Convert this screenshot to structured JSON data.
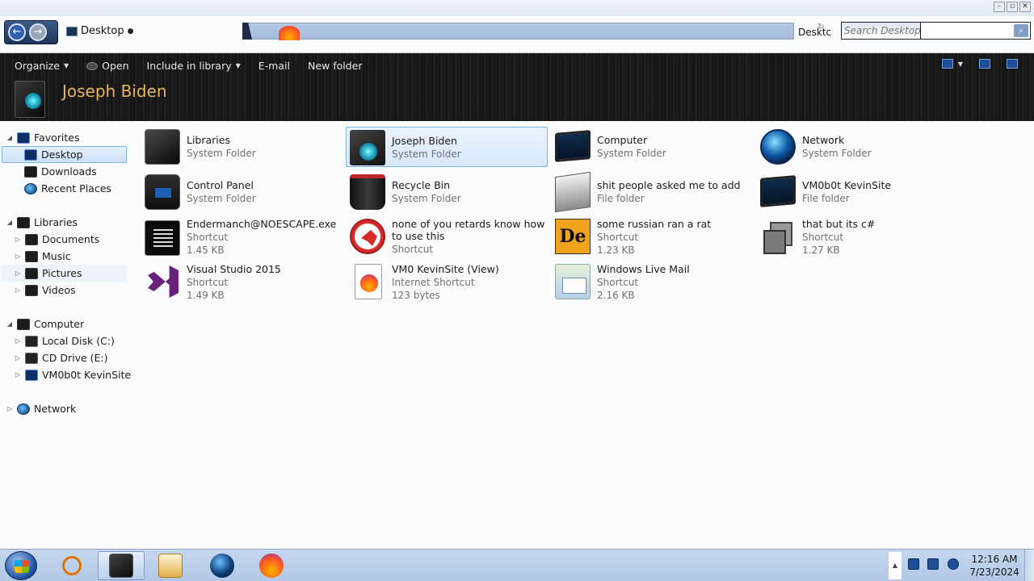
{
  "address": {
    "breadcrumb": "Desktop",
    "location_label": "Desktc",
    "search_placeholder": "Search Desktop"
  },
  "window_controls": [
    "–",
    "▫",
    "✕"
  ],
  "toolbar": {
    "organize": "Organize",
    "open": "Open",
    "include": "Include in library",
    "email": "E-mail",
    "new_folder": "New folder"
  },
  "header": {
    "title": "Joseph Biden"
  },
  "nav": {
    "favorites": "Favorites",
    "desktop": "Desktop",
    "downloads": "Downloads",
    "recent": "Recent Places",
    "libraries": "Libraries",
    "documents": "Documents",
    "music": "Music",
    "pictures": "Pictures",
    "videos": "Videos",
    "computer": "Computer",
    "local_disk": "Local Disk (C:)",
    "cd_drive": "CD Drive (E:)",
    "vm_site": "VM0b0t KevinSite",
    "network": "Network"
  },
  "items": [
    {
      "name": "Libraries",
      "type": "System Folder",
      "size": "",
      "icon": "libraries-icon"
    },
    {
      "name": "Joseph Biden",
      "type": "System Folder",
      "size": "",
      "icon": "user-folder-icon"
    },
    {
      "name": "Computer",
      "type": "System Folder",
      "size": "",
      "icon": "computer-icon"
    },
    {
      "name": "Network",
      "type": "System Folder",
      "size": "",
      "icon": "network-globe-icon"
    },
    {
      "name": "Control Panel",
      "type": "System Folder",
      "size": "",
      "icon": "control-panel-icon"
    },
    {
      "name": "Recycle Bin",
      "type": "System Folder",
      "size": "",
      "icon": "recycle-bin-icon"
    },
    {
      "name": "shit people asked me to add",
      "type": "File folder",
      "size": "",
      "icon": "folder-icon"
    },
    {
      "name": "VM0b0t KevinSite",
      "type": "File folder",
      "size": "",
      "icon": "monitor-folder-icon"
    },
    {
      "name": "Endermanch@NOESCAPE.exe",
      "type": "Shortcut",
      "size": "1.45 KB",
      "icon": "exe-icon"
    },
    {
      "name": "none of you retards know how to use this",
      "type": "Shortcut",
      "size": "",
      "icon": "rat-icon"
    },
    {
      "name": "some russian ran a rat",
      "type": "Shortcut",
      "size": "1.23 KB",
      "icon": "de-icon"
    },
    {
      "name": "that but its c#",
      "type": "Shortcut",
      "size": "1.27 KB",
      "icon": "stack-icon"
    },
    {
      "name": "Visual Studio 2015",
      "type": "Shortcut",
      "size": "1.49 KB",
      "icon": "visual-studio-icon"
    },
    {
      "name": "VM0 KevinSite (View)",
      "type": "Internet Shortcut",
      "size": "123 bytes",
      "icon": "firefox-doc-icon"
    },
    {
      "name": "Windows Live Mail",
      "type": "Shortcut",
      "size": "2.16 KB",
      "icon": "mail-icon"
    }
  ],
  "taskbar": {
    "time": "12:16 AM",
    "date": "7/23/2024"
  }
}
